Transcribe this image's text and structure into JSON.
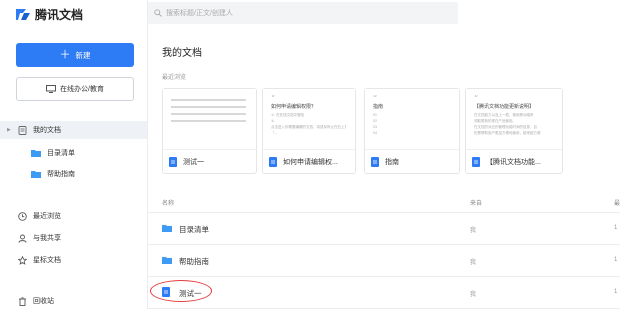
{
  "app": {
    "logo_text": "腾讯文档"
  },
  "sidebar": {
    "new_button": "新建",
    "edu_button": "在线办公/教育",
    "nav": {
      "my_docs": "我的文档",
      "folder1": "目录清单",
      "folder2": "帮助指南",
      "recent": "最近浏览",
      "shared": "与我共享",
      "starred": "星标文档",
      "trash": "回收站"
    }
  },
  "search": {
    "placeholder": "搜索标题/正文/创建人"
  },
  "main": {
    "title": "我的文档",
    "recent_label": "最近浏览",
    "cards": [
      {
        "name": "测试一"
      },
      {
        "name": "如何申请编辑权...",
        "preview_title": "如何申请编辑权限？",
        "preview_lines": [
          "①. 在在线文档中登陆",
          "②.",
          "点击进入你需要编辑的文档，将鼠标停止在右上角的「问题反馈」",
          "「..."
        ]
      },
      {
        "name": "指南",
        "preview_title": "指南",
        "preview_lines": [
          "01",
          "02",
          "03",
          "04"
        ]
      },
      {
        "name": "【腾讯文档功能...",
        "preview_title": "【腾讯文档功能更新说明】",
        "preview_lines": [
          "在文档能力以及上一般，使用移动端来",
          "领取更新的现在产品使用。",
          "在文档的对应的管理功能时间的信息，目",
          "的是帮助用户更加方便地使用，越来越方便"
        ]
      }
    ],
    "table": {
      "col_name": "名称",
      "col_source": "来自",
      "col_edge": "最",
      "rows": [
        {
          "name": "目录清单",
          "source": "我",
          "edge": "1",
          "type": "folder"
        },
        {
          "name": "帮助指南",
          "source": "我",
          "edge": "1",
          "type": "folder"
        },
        {
          "name": "测试一",
          "source": "我",
          "edge": "1",
          "type": "doc"
        }
      ]
    }
  },
  "colors": {
    "accent": "#2e7bf6",
    "folder": "#3d9bf5",
    "annotation": "#e23b3b"
  }
}
